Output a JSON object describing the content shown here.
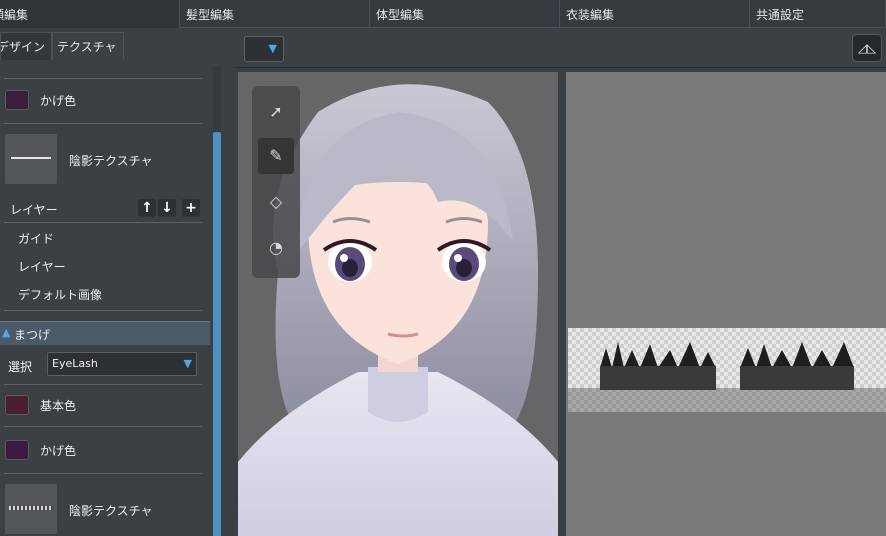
{
  "top_tabs": [
    {
      "label": "顔編集"
    },
    {
      "label": "髪型編集"
    },
    {
      "label": "体型編集"
    },
    {
      "label": "衣装編集"
    },
    {
      "label": "共通設定"
    }
  ],
  "left_panel": {
    "subtabs": [
      {
        "label": "デザイン"
      },
      {
        "label": "テクスチャ"
      }
    ],
    "upper": {
      "shadow_color_label": "かげ色",
      "shadow_color": "#3a1f3a",
      "shade_texture_label": "陰影テクスチャ",
      "layer_header": "レイヤー",
      "layer_up_icon": "arrow-up-icon",
      "layer_down_icon": "arrow-down-icon",
      "layer_add_icon": "plus-icon",
      "layer_items": [
        "ガイド",
        "レイヤー",
        "デフォルト画像"
      ]
    },
    "eyelash_section": {
      "title": "まつげ",
      "select_label": "選択",
      "select_value": "EyeLash",
      "base_color_label": "基本色",
      "base_color": "#4a1f30",
      "shadow_color_label": "かげ色",
      "shadow_color": "#3c1a44",
      "shade_texture_label": "陰影テクスチャ"
    }
  },
  "toolbar": {
    "mirror_icon": "mirror-icon"
  },
  "tools": [
    {
      "name": "select-arrow-icon",
      "glyph": "➚"
    },
    {
      "name": "pencil-icon",
      "glyph": "✎"
    },
    {
      "name": "eraser-icon",
      "glyph": "◇"
    },
    {
      "name": "dropper-icon",
      "glyph": "◔"
    }
  ],
  "colors": {
    "accent": "#4fa8ec"
  }
}
